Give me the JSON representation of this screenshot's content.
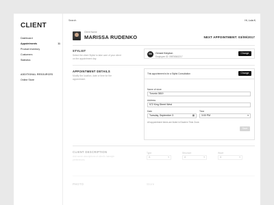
{
  "sidebar": {
    "logo": "CLIENT",
    "items": [
      {
        "label": "Dashboard",
        "count": ""
      },
      {
        "label": "Appointments",
        "count": "11"
      },
      {
        "label": "Product Inventory",
        "count": ""
      },
      {
        "label": "Customers",
        "count": ""
      },
      {
        "label": "Statistics",
        "count": ""
      }
    ],
    "resources_heading": "ADDITIONAL RESOURCES",
    "resources_items": [
      {
        "label": "Online Store"
      }
    ]
  },
  "topbar": {
    "search_label": "Search",
    "greeting": "Hi, Lola K."
  },
  "client": {
    "label": "Client Name",
    "name": "MARISSA RUDENKO",
    "next_appointment": "NEXT APPOINTMENT: 03/09/2017"
  },
  "stylist_section": {
    "title": "STYLIST",
    "description": "Select the client Stylist to take care of your client on the appointment day.",
    "initials": "GK",
    "name": "Gerard Kimpton",
    "employee_id": "Employee ID: 09876543217",
    "change_label": "Change"
  },
  "appointment_section": {
    "title": "APPOINTMENT DETAILS",
    "description": "Modify the location, date or time for the appointment.",
    "type_text": "This appointment is for a Stylist Consultation",
    "change_label": "Change",
    "store_label": "Name of store",
    "store_value": "Toronto 3819",
    "address_label": "Address",
    "address_value": "572 King Street West",
    "date_label": "Date",
    "date_value": "Tuesday, September 3",
    "time_label": "Time",
    "time_value": "3:00 PM",
    "timezone_note": "All appointment times are listed in Eastern Time Zone.",
    "save_label": "Save"
  },
  "description_section": {
    "title": "CLIENT DESCRIPTION",
    "description": "Add some descriptions of client's hairstyle preferences.",
    "fields": [
      {
        "label": "Type",
        "value": "A"
      },
      {
        "label": "Structure",
        "value": "A"
      },
      {
        "label": "Wave",
        "value": "A"
      }
    ]
  },
  "bottom_section": {
    "title": "PHOTO",
    "sub_label": "Store"
  }
}
